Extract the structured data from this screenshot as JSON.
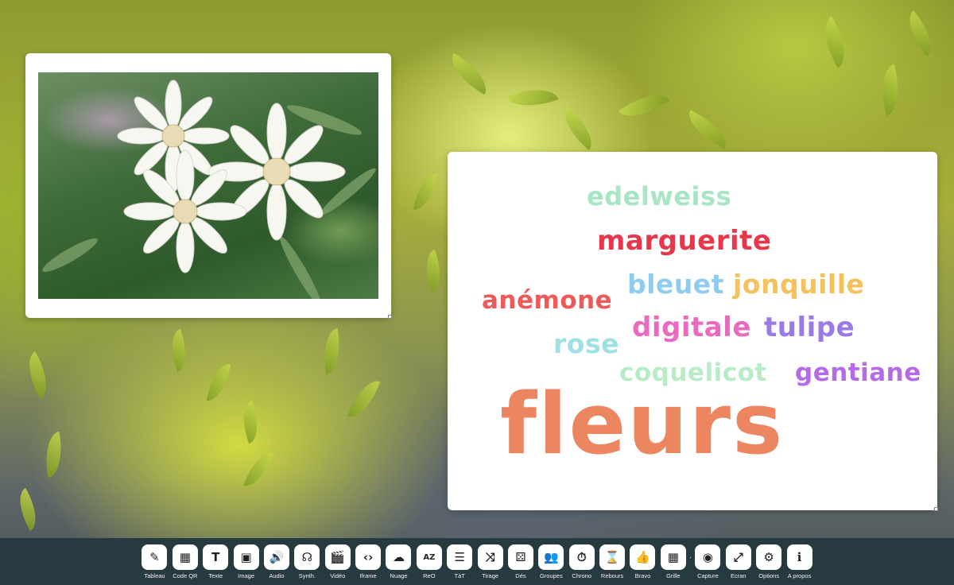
{
  "word_cloud": {
    "words": [
      {
        "text": "edelweiss",
        "color": "#a8e6c3"
      },
      {
        "text": "marguerite",
        "color": "#e8374a"
      },
      {
        "text": "anémone",
        "color": "#ee5a5a"
      },
      {
        "text": "bleuet",
        "color": "#8fcdf0"
      },
      {
        "text": "jonquille",
        "color": "#f4c15c"
      },
      {
        "text": "rose",
        "color": "#9fe0e3"
      },
      {
        "text": "digitale",
        "color": "#e96bc0"
      },
      {
        "text": "tulipe",
        "color": "#9a7ae6"
      },
      {
        "text": "coquelicot",
        "color": "#b8ecc7"
      },
      {
        "text": "gentiane",
        "color": "#b56ae6"
      },
      {
        "text": "fleurs",
        "color": "#ec8660"
      }
    ]
  },
  "toolbar": {
    "items": [
      {
        "label": "Tableau",
        "icon": "pen-icon",
        "glyph": "✎"
      },
      {
        "label": "Code QR",
        "icon": "qr-code-icon",
        "glyph": "▦"
      },
      {
        "label": "Texte",
        "icon": "text-icon",
        "glyph": "T"
      },
      {
        "label": "Image",
        "icon": "image-icon",
        "glyph": "▣"
      },
      {
        "label": "Audio",
        "icon": "speaker-icon",
        "glyph": "🔊"
      },
      {
        "label": "Synth.",
        "icon": "voice-icon",
        "glyph": "☊"
      },
      {
        "label": "Vidéo",
        "icon": "clapperboard-icon",
        "glyph": "🎬"
      },
      {
        "label": "Iframe",
        "icon": "code-icon",
        "glyph": "‹›"
      },
      {
        "label": "Nuage",
        "icon": "cloud-icon",
        "glyph": "☁"
      },
      {
        "label": "ReO",
        "icon": "sort-az-icon",
        "glyph": "AZ"
      },
      {
        "label": "TàT",
        "icon": "document-icon",
        "glyph": "☰"
      },
      {
        "label": "Tirage",
        "icon": "shuffle-icon",
        "glyph": "⤨"
      },
      {
        "label": "Dés",
        "icon": "dice-icon",
        "glyph": "⚄"
      },
      {
        "label": "Groupes",
        "icon": "people-icon",
        "glyph": "👥"
      },
      {
        "label": "Chrono",
        "icon": "stopwatch-icon",
        "glyph": "⏱"
      },
      {
        "label": "Rebours",
        "icon": "hourglass-icon",
        "glyph": "⌛"
      },
      {
        "label": "Bravo",
        "icon": "thumbs-up-icon",
        "glyph": "👍"
      },
      {
        "label": "Grille",
        "icon": "grid-icon",
        "glyph": "▦"
      },
      {
        "label": "Capture",
        "icon": "camera-shutter-icon",
        "glyph": "◉"
      },
      {
        "label": "Ecran",
        "icon": "fullscreen-icon",
        "glyph": "⤢"
      },
      {
        "label": "Options",
        "icon": "gear-icon",
        "glyph": "⚙"
      },
      {
        "label": "A propos",
        "icon": "info-icon",
        "glyph": "ℹ"
      }
    ]
  }
}
